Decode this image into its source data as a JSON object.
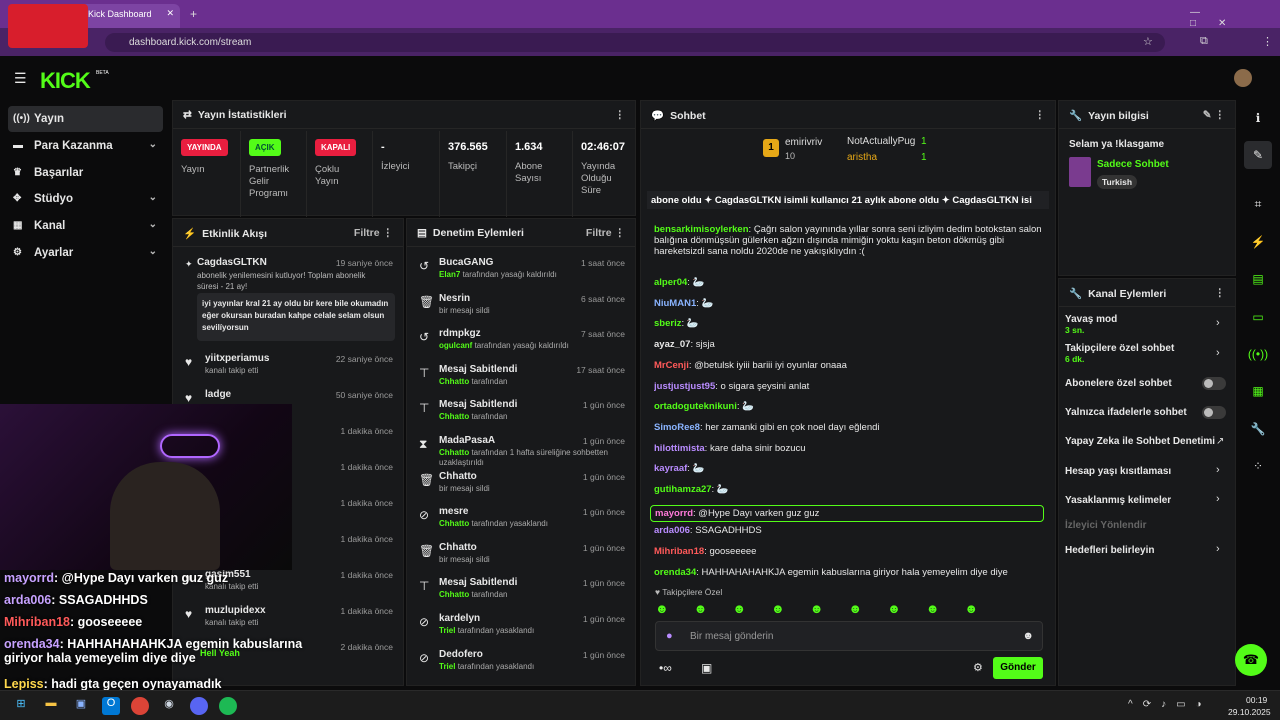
{
  "browser": {
    "tab_title": "Kick Dashboard",
    "url": "dashboard.kick.com/stream"
  },
  "app": {
    "logo": "KICK",
    "logo_sup": "BETA"
  },
  "sidebar": {
    "items": [
      {
        "label": "Yayın",
        "icon": "broadcast-icon"
      },
      {
        "label": "Para Kazanma",
        "icon": "money-icon"
      },
      {
        "label": "Başarılar",
        "icon": "trophy-icon"
      },
      {
        "label": "Stüdyo",
        "icon": "studio-icon"
      },
      {
        "label": "Kanal",
        "icon": "channel-icon"
      },
      {
        "label": "Ayarlar",
        "icon": "gear-icon"
      }
    ]
  },
  "stats": {
    "title": "Yayın İstatistikleri",
    "items": [
      {
        "badge": "YAYINDA",
        "label": "Yayın",
        "badge_color": "#e91e3f"
      },
      {
        "badge": "AÇIK",
        "label": "Partnerlik Gelir Programı",
        "badge_color": "#53fc18"
      },
      {
        "badge": "KAPALI",
        "label": "Çoklu Yayın",
        "badge_color": "#e91e3f"
      },
      {
        "value": "-",
        "label": "İzleyici"
      },
      {
        "value": "376.565",
        "label": "Takipçi"
      },
      {
        "value": "1.634",
        "label": "Abone Sayısı"
      },
      {
        "value": "02:46:07",
        "label": "Yayında Olduğu Süre"
      }
    ]
  },
  "activity": {
    "title": "Etkinlik Akışı",
    "filter": "Filtre",
    "top": {
      "name": "CagdasGLTKN",
      "time": "19 saniye önce",
      "desc": "abonelik yenilemesini kutluyor! Toplam abonelik süresi - 21 ay!",
      "message": "iyi yayınlar kral 21 ay oldu bir kere bile okumadın eğer okursan buradan kahpe celale selam olsun sevilíyorsun"
    },
    "items": [
      {
        "name": "yiitxperiamus",
        "time": "22 saniye önce",
        "sub": "kanalı takip etti"
      },
      {
        "name": "ladge",
        "time": "50 saniye önce",
        "sub": ""
      },
      {
        "name": "",
        "time": "1 dakika önce",
        "sub": ""
      },
      {
        "name": "",
        "time": "1 dakika önce",
        "sub": ""
      },
      {
        "name": "",
        "time": "1 dakika önce",
        "sub": ""
      },
      {
        "name": "",
        "time": "1 dakika önce",
        "sub": ""
      },
      {
        "name": "gasim551",
        "time": "1 dakika önce",
        "sub": "kanalı takip etti"
      },
      {
        "name": "muzlupidexx",
        "time": "1 dakika önce",
        "sub": "kanalı takip etti"
      },
      {
        "name": "",
        "time": "2 dakika önce",
        "sub": ""
      }
    ]
  },
  "moderation": {
    "title": "Denetim Eylemleri",
    "filter": "Filtre",
    "items": [
      {
        "icon": "undo-icon",
        "name": "BucaGANG",
        "time": "1 saat önce",
        "actor": "Elan7",
        "text": "tarafından yasağı kaldırıldı"
      },
      {
        "icon": "trash-icon",
        "name": "Nesrin",
        "time": "6 saat önce",
        "actor": "",
        "text": "bir mesajı sildi"
      },
      {
        "icon": "undo-icon",
        "name": "rdmpkgz",
        "time": "7 saat önce",
        "actor": "ogulcanf",
        "text": "tarafından yasağı kaldırıldı"
      },
      {
        "icon": "pin-icon",
        "name": "Mesaj Sabitlendi",
        "time": "17 saat önce",
        "actor": "Chhatto",
        "text": "tarafından"
      },
      {
        "icon": "pin-icon",
        "name": "Mesaj Sabitlendi",
        "time": "1 gün önce",
        "actor": "Chhatto",
        "text": "tarafından"
      },
      {
        "icon": "hourglass-icon",
        "name": "MadaPasaA",
        "time": "1 gün önce",
        "actor": "Chhatto",
        "text": "tarafından 1 hafta süreliğine sohbetten uzaklaştırıldı"
      },
      {
        "icon": "trash-icon",
        "name": "Chhatto",
        "time": "1 gün önce",
        "actor": "",
        "text": "bir mesajı sildi"
      },
      {
        "icon": "ban-icon",
        "name": "mesre",
        "time": "1 gün önce",
        "actor": "Chhatto",
        "text": "tarafından yasaklandı"
      },
      {
        "icon": "trash-icon",
        "name": "Chhatto",
        "time": "1 gün önce",
        "actor": "",
        "text": "bir mesajı sildi"
      },
      {
        "icon": "pin-icon",
        "name": "Mesaj Sabitlendi",
        "time": "1 gün önce",
        "actor": "Chhatto",
        "text": "tarafından"
      },
      {
        "icon": "ban-icon",
        "name": "kardelyn",
        "time": "1 gün önce",
        "actor": "Triel",
        "text": "tarafından yasaklandı"
      },
      {
        "icon": "ban-icon",
        "name": "Dedofero",
        "time": "1 gün önce",
        "actor": "Triel",
        "text": "tarafından yasaklandı"
      }
    ]
  },
  "chat": {
    "title": "Sohbet",
    "leaders": [
      {
        "rank": "1",
        "name": "emirivriv",
        "count": "10"
      },
      {
        "rank": "",
        "name": "NotActuallyPug",
        "count": "1"
      },
      {
        "rank": "",
        "name": "aristha",
        "count": "1"
      }
    ],
    "ticker": "abone oldu  ✦  CagdasGLTKN isimli kullanıcı 21 aylık abone oldu  ✦  CagdasGLTKN isi",
    "messages": [
      {
        "user": "bensarkimisoylerken",
        "color": "#53fc18",
        "text": "Çağrı salon yayınında yıllar sonra seni izliyim dedim botokstan salon balığına dönmüşsün gülerken ağzın dışında mimiğin yoktu kaşın beton dökmüş gibi hareketsizdi sana noldu 2020de ne yakışıklıydın :("
      },
      {
        "user": "alper04",
        "color": "#53fc18",
        "text": "🦢"
      },
      {
        "user": "NiuMAN1",
        "color": "#8ab4ff",
        "text": "🦢"
      },
      {
        "user": "sberiz",
        "color": "#53fc18",
        "text": "🦢"
      },
      {
        "user": "ayaz_07",
        "color": "#e8e8e8",
        "text": "sjsja"
      },
      {
        "user": "MrCenji",
        "color": "#ff5a5a",
        "text": "@betulsk iyiii bariii iyi oyunlar onaaa"
      },
      {
        "user": "justjustjust95",
        "color": "#b98cff",
        "text": "o sigara şeysini anlat"
      },
      {
        "user": "ortadoguteknikuni",
        "color": "#53fc18",
        "text": "🦢"
      },
      {
        "user": "SimoRee8",
        "color": "#8ab4ff",
        "text": "her zamanki gibi en çok noel dayı eğlendi"
      },
      {
        "user": "hilottimista",
        "color": "#b98cff",
        "text": "kare daha sinir bozucu"
      },
      {
        "user": "kayraaf",
        "color": "#b98cff",
        "text": "🦢"
      },
      {
        "user": "gutihamza27",
        "color": "#53fc18",
        "text": "🦢"
      },
      {
        "user": "mayorrd",
        "color": "#ff7ad9",
        "text": "@Hype Dayı varken guz guz"
      },
      {
        "user": "arda006",
        "color": "#b98cff",
        "text": "SSAGADHHDS"
      },
      {
        "user": "Mihriban18",
        "color": "#ff5a5a",
        "text": "gooseeeee"
      },
      {
        "user": "orenda34",
        "color": "#53fc18",
        "text": "HAHHAHAHAHKJA egemin kabuslarına giriyor hala yemeyelim diye diye"
      }
    ],
    "followers_only": "Takipçilere Özel",
    "input_placeholder": "Bir mesaj gönderin",
    "send_button": "Gönder"
  },
  "stream_info": {
    "title": "Yayın bilgisi",
    "stream_title": "Selam ya !klasgame",
    "category": "Sadece Sohbet",
    "tag": "Turkish"
  },
  "channel_actions": {
    "title": "Kanal Eylemleri",
    "items": [
      {
        "label": "Yavaş mod",
        "sub": "3 sn.",
        "type": "arrow"
      },
      {
        "label": "Takipçilere özel sohbet",
        "sub": "6 dk.",
        "type": "arrow"
      },
      {
        "label": "Abonelere özel sohbet",
        "sub": "",
        "type": "toggle"
      },
      {
        "label": "Yalnızca ifadelerle sohbet",
        "sub": "",
        "type": "toggle"
      },
      {
        "label": "Yapay Zeka ile Sohbet Denetimi",
        "sub": "",
        "type": "external"
      },
      {
        "label": "Hesap yaşı kısıtlaması",
        "sub": "",
        "type": "arrow"
      },
      {
        "label": "Yasaklanmış kelimeler",
        "sub": "",
        "type": "arrow"
      },
      {
        "label": "İzleyici Yönlendir",
        "sub": "",
        "type": "disabled"
      },
      {
        "label": "Hedefleri belirleyin",
        "sub": "",
        "type": "arrow"
      }
    ]
  },
  "overlay_chat": [
    {
      "user": "mayorrd",
      "color": "#c7a2ff",
      "text": ": @Hype Dayı varken guz guz"
    },
    {
      "user": "arda006",
      "color": "#c7a2ff",
      "text": ": SSAGADHHDS"
    },
    {
      "user": "Mihriban18",
      "color": "#ff5a5a",
      "text": ": gooseeeee"
    },
    {
      "user": "orenda34",
      "color": "#c7a2ff",
      "text": ": HAHHAHAHAHKJA egemin kabuslarına giriyor hala yemeyelim diye diye"
    },
    {
      "user": "Lepiss",
      "color": "#ffd84d",
      "text": ": hadi gta geçen oynayamadık"
    }
  ],
  "overlay_event": {
    "name": "Hell Yeah"
  },
  "taskbar": {
    "time": "00:19",
    "date": "29.10.2025"
  }
}
